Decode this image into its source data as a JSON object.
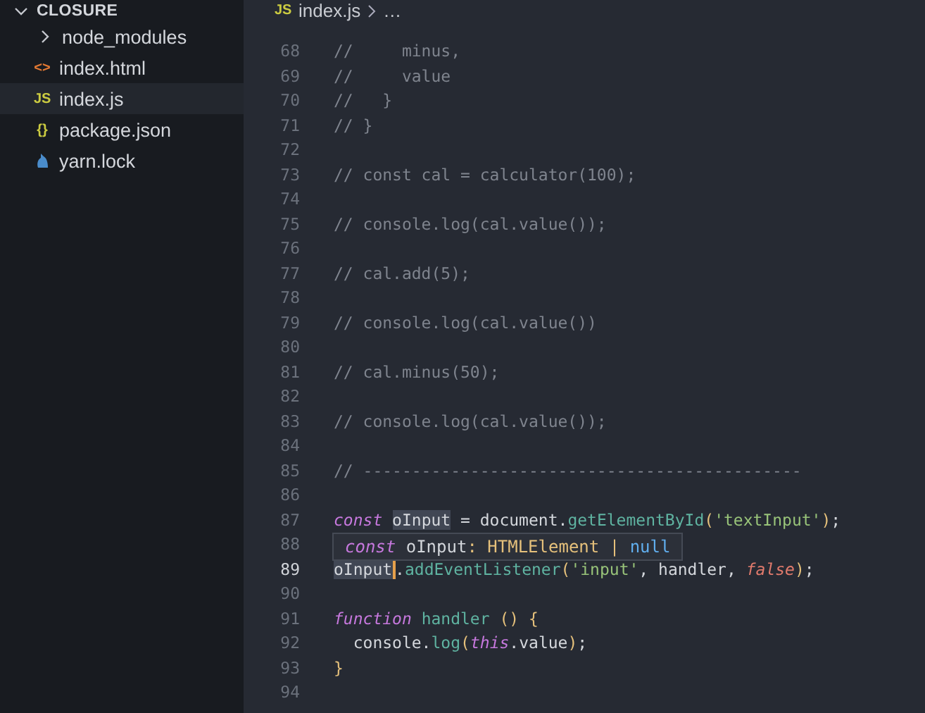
{
  "explorer": {
    "title": "CLOSURE",
    "expanded": true,
    "items": [
      {
        "label": "node_modules",
        "kind": "folder",
        "expanded": false,
        "selected": false
      },
      {
        "label": "index.html",
        "kind": "html",
        "icon": "<>",
        "selected": false
      },
      {
        "label": "index.js",
        "kind": "js",
        "icon": "JS",
        "selected": true
      },
      {
        "label": "package.json",
        "kind": "json",
        "icon": "{}",
        "selected": false
      },
      {
        "label": "yarn.lock",
        "kind": "yarn",
        "selected": false
      }
    ]
  },
  "breadcrumb": {
    "icon": "JS",
    "file": "index.js",
    "rest": "…"
  },
  "editor": {
    "lines": [
      {
        "number": "68",
        "current": false,
        "tokens": [
          {
            "text": "//     minus,",
            "kind": "comment"
          }
        ]
      },
      {
        "number": "69",
        "current": false,
        "tokens": [
          {
            "text": "//     value",
            "kind": "comment"
          }
        ]
      },
      {
        "number": "70",
        "current": false,
        "tokens": [
          {
            "text": "//   }",
            "kind": "comment"
          }
        ]
      },
      {
        "number": "71",
        "current": false,
        "tokens": [
          {
            "text": "// }",
            "kind": "comment"
          }
        ]
      },
      {
        "number": "72",
        "current": false
      },
      {
        "number": "73",
        "current": false,
        "tokens": [
          {
            "text": "// const cal = calculator(100);",
            "kind": "comment"
          }
        ]
      },
      {
        "number": "74",
        "current": false
      },
      {
        "number": "75",
        "current": false,
        "tokens": [
          {
            "text": "// console.log(cal.value());",
            "kind": "comment"
          }
        ]
      },
      {
        "number": "76",
        "current": false
      },
      {
        "number": "77",
        "current": false,
        "tokens": [
          {
            "text": "// cal.add(5);",
            "kind": "comment"
          }
        ]
      },
      {
        "number": "78",
        "current": false
      },
      {
        "number": "79",
        "current": false,
        "tokens": [
          {
            "text": "// console.log(cal.value())",
            "kind": "comment"
          }
        ]
      },
      {
        "number": "80",
        "current": false
      },
      {
        "number": "81",
        "current": false,
        "tokens": [
          {
            "text": "// cal.minus(50);",
            "kind": "comment"
          }
        ]
      },
      {
        "number": "82",
        "current": false
      },
      {
        "number": "83",
        "current": false,
        "tokens": [
          {
            "text": "// console.log(cal.value());",
            "kind": "comment"
          }
        ]
      },
      {
        "number": "84",
        "current": false
      },
      {
        "number": "85",
        "current": false,
        "tokens": [
          {
            "text": "// ---------------------------------------------",
            "kind": "comment"
          }
        ]
      },
      {
        "number": "86",
        "current": false
      },
      {
        "number": "87",
        "current": false,
        "tokens": [
          {
            "text": "const ",
            "kind": "keyword"
          },
          {
            "text": "oInput",
            "kind": "plain",
            "highlighted": true
          },
          {
            "text": " = document.",
            "kind": "plain"
          },
          {
            "text": "getElementById",
            "kind": "func"
          },
          {
            "text": "(",
            "kind": "punct"
          },
          {
            "text": "'textInput'",
            "kind": "string"
          },
          {
            "text": ")",
            "kind": "punct"
          },
          {
            "text": ";",
            "kind": "plain"
          }
        ],
        "hover": {
          "tokens": [
            {
              "text": "const",
              "kind": "keyword"
            },
            {
              "text": " oInput",
              "kind": "plain"
            },
            {
              "text": ": ",
              "kind": "punct"
            },
            {
              "text": "HTMLElement",
              "kind": "type"
            },
            {
              "text": " | ",
              "kind": "punct"
            },
            {
              "text": "null",
              "kind": "null"
            }
          ]
        }
      },
      {
        "number": "88",
        "current": false
      },
      {
        "number": "89",
        "current": true,
        "tokens": [
          {
            "text": "oInput",
            "kind": "plain",
            "highlighted": true,
            "caret": true
          },
          {
            "text": ".",
            "kind": "plain"
          },
          {
            "text": "addEventListener",
            "kind": "func"
          },
          {
            "text": "(",
            "kind": "punct"
          },
          {
            "text": "'input'",
            "kind": "string"
          },
          {
            "text": ", handler, ",
            "kind": "plain"
          },
          {
            "text": "false",
            "kind": "bool"
          },
          {
            "text": ")",
            "kind": "punct"
          },
          {
            "text": ";",
            "kind": "plain"
          }
        ]
      },
      {
        "number": "90",
        "current": false
      },
      {
        "number": "91",
        "current": false,
        "tokens": [
          {
            "text": "function ",
            "kind": "keyword"
          },
          {
            "text": "handler ",
            "kind": "func"
          },
          {
            "text": "() {",
            "kind": "punct"
          }
        ]
      },
      {
        "number": "92",
        "current": false,
        "tokens": [
          {
            "text": "  console.",
            "kind": "plain"
          },
          {
            "text": "log",
            "kind": "func"
          },
          {
            "text": "(",
            "kind": "punct"
          },
          {
            "text": "this",
            "kind": "keyword"
          },
          {
            "text": ".value",
            "kind": "plain"
          },
          {
            "text": ")",
            "kind": "punct"
          },
          {
            "text": ";",
            "kind": "plain"
          }
        ]
      },
      {
        "number": "93",
        "current": false,
        "tokens": [
          {
            "text": "}",
            "kind": "punct"
          }
        ]
      },
      {
        "number": "94",
        "current": false
      }
    ]
  }
}
